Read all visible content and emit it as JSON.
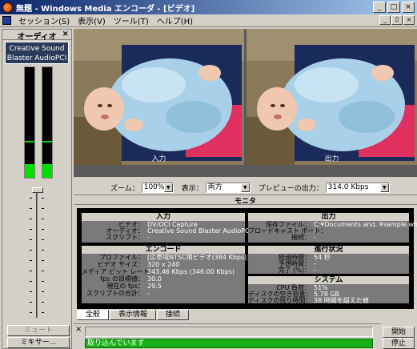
{
  "window": {
    "title": "無題 - Windows Media エンコーダ - [ビデオ]",
    "controls": [
      "_",
      "□",
      "×"
    ],
    "mdi_controls": [
      "_",
      "ﾛ",
      "×"
    ]
  },
  "menu": [
    "セッション(S)",
    "表示(V)",
    "ツール(T)",
    "ヘルプ(H)"
  ],
  "audio": {
    "header": "オーディオ",
    "close": "×",
    "device": "Creative Sound Blaster AudioPCI",
    "levels": [
      0.12,
      0.12
    ],
    "peaks": [
      0.32,
      0.32
    ],
    "volume": 1.0,
    "mute_label": "ミュート",
    "mixer_label": "ミキサー..."
  },
  "video": {
    "input_label": "入力",
    "output_label": "出力"
  },
  "controls": {
    "zoom_label": "ズーム：",
    "zoom_value": "100%",
    "display_label": "表示：",
    "display_value": "両方",
    "preview_label": "プレビューの出力：",
    "preview_value": "314.0 Kbps"
  },
  "monitor": {
    "header": "モニタ",
    "input": {
      "title": "入力",
      "rows": [
        {
          "k": "ビデオ：",
          "v": "DV/OCI Capture"
        },
        {
          "k": "オーディオ：",
          "v": "Creative Sound Blaster AudioPCI"
        },
        {
          "k": "スクリプト：",
          "v": "-"
        }
      ]
    },
    "output": {
      "title": "出力",
      "rows": [
        {
          "k": "保存ファイル：",
          "v": "C:¥Documents and..¥sample.wmv"
        },
        {
          "k": "ブロードキャスト ポート：",
          "v": "-"
        },
        {
          "k": "接続：",
          "v": "-"
        }
      ]
    },
    "encode": {
      "title": "エンコード",
      "rows": [
        {
          "k": "プロファイル：",
          "v": "[広帯域NTSC用ビデオ(384 Kbps)]"
        },
        {
          "k": "ビデオ サイズ：",
          "v": "320 x 240"
        },
        {
          "k": "メディア ビット レート：",
          "v": "343.46 Kbps (346.00 Kbps)"
        },
        {
          "k": "fps の目標値：",
          "v": "30.0"
        },
        {
          "k": "現在の fps：",
          "v": "29.5"
        },
        {
          "k": "スクリプトの合計：",
          "v": "-"
        }
      ]
    },
    "progress": {
      "title": "進行状況",
      "rows": [
        {
          "k": "経過時間：",
          "v": "54 秒"
        },
        {
          "k": "予想時間：",
          "v": "-"
        },
        {
          "k": "完了 (%)：",
          "v": "-"
        }
      ]
    },
    "system": {
      "title": "システム",
      "rows": [
        {
          "k": "CPU 負荷：",
          "v": "51%"
        },
        {
          "k": "ディスクの空き容量：",
          "v": "5.78 GB"
        },
        {
          "k": "ディスクの残り時間：",
          "v": "38 時間を超えた値"
        }
      ]
    }
  },
  "tabs": [
    "全般",
    "表示情報",
    "接続"
  ],
  "status": {
    "close": "×",
    "message": "取り込んでいます"
  },
  "actions": {
    "start": "開始",
    "stop": "停止"
  },
  "colors": {
    "titlebar_start": "#0a246a",
    "meter_level": "#00e000",
    "status_bar": "#18b018"
  }
}
